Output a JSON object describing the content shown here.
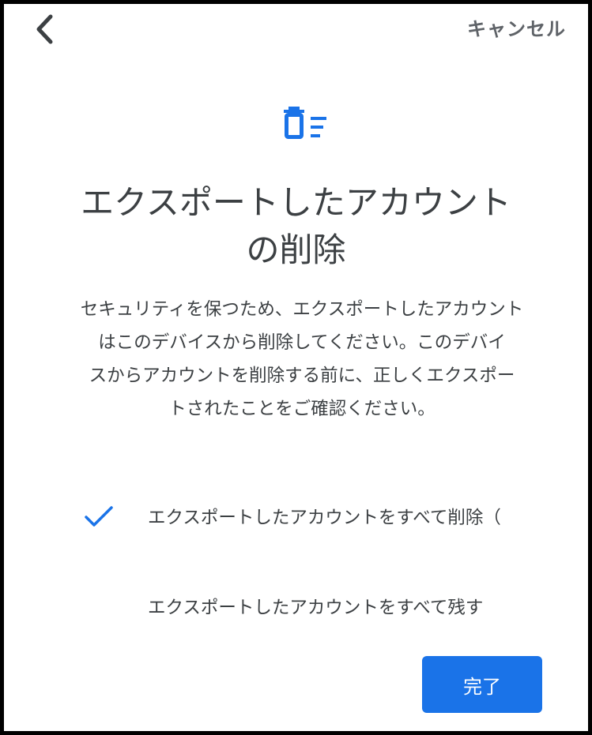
{
  "header": {
    "back_icon": "chevron-left-icon",
    "cancel_label": "キャンセル"
  },
  "hero": {
    "icon": "delete-sweep-icon",
    "accent_color": "#1a73e8"
  },
  "title": {
    "line1": "エクスポートしたアカウント",
    "line2": "の削除"
  },
  "description": {
    "line1": "セキュリティを保つため、エクスポートしたアカウント",
    "line2": "はこのデバイスから削除してください。このデバイ",
    "line3": "スからアカウントを削除する前に、正しくエクスポー",
    "line4": "トされたことをご確認ください。"
  },
  "options": [
    {
      "label": "エクスポートしたアカウントをすべて削除（",
      "selected": true,
      "check_icon": "checkmark-icon"
    },
    {
      "label": "エクスポートしたアカウントをすべて残す",
      "selected": false
    }
  ],
  "footer": {
    "done_label": "完了",
    "button_color": "#1a73e8"
  }
}
